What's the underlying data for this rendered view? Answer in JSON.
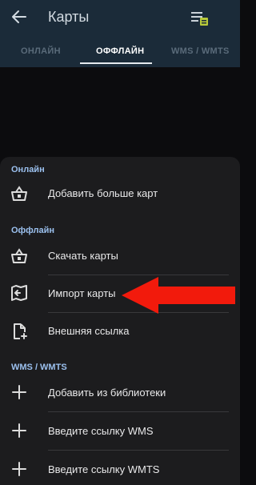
{
  "app_bar": {
    "title": "Карты",
    "back_icon": "arrow-left-icon",
    "action_icon": "layers-list-icon"
  },
  "tabs": [
    {
      "label": "ОНЛАЙН",
      "active": false
    },
    {
      "label": "ОФФЛАЙН",
      "active": true
    },
    {
      "label": "WMS / WMTS",
      "active": false
    }
  ],
  "sheet": {
    "sections": [
      {
        "header": "Онлайн",
        "items": [
          {
            "label": "Добавить больше карт",
            "icon": "shop-basket-icon"
          }
        ]
      },
      {
        "header": "Оффлайн",
        "items": [
          {
            "label": "Скачать карты",
            "icon": "shop-basket-icon"
          },
          {
            "label": "Импорт карты",
            "icon": "map-import-icon"
          },
          {
            "label": "Внешняя ссылка",
            "icon": "file-add-icon"
          }
        ]
      },
      {
        "header": "WMS / WMTS",
        "items": [
          {
            "label": "Добавить из библиотеки",
            "icon": "plus-icon"
          },
          {
            "label": "Введите ссылку WMS",
            "icon": "plus-icon"
          },
          {
            "label": "Введите ссылку WMTS",
            "icon": "plus-icon"
          }
        ]
      }
    ]
  },
  "colors": {
    "app_bar_bg": "#1b2b39",
    "sheet_bg": "#1c1c1e",
    "section_header": "#9bc0ee",
    "highlight_arrow": "#f21a0c"
  }
}
